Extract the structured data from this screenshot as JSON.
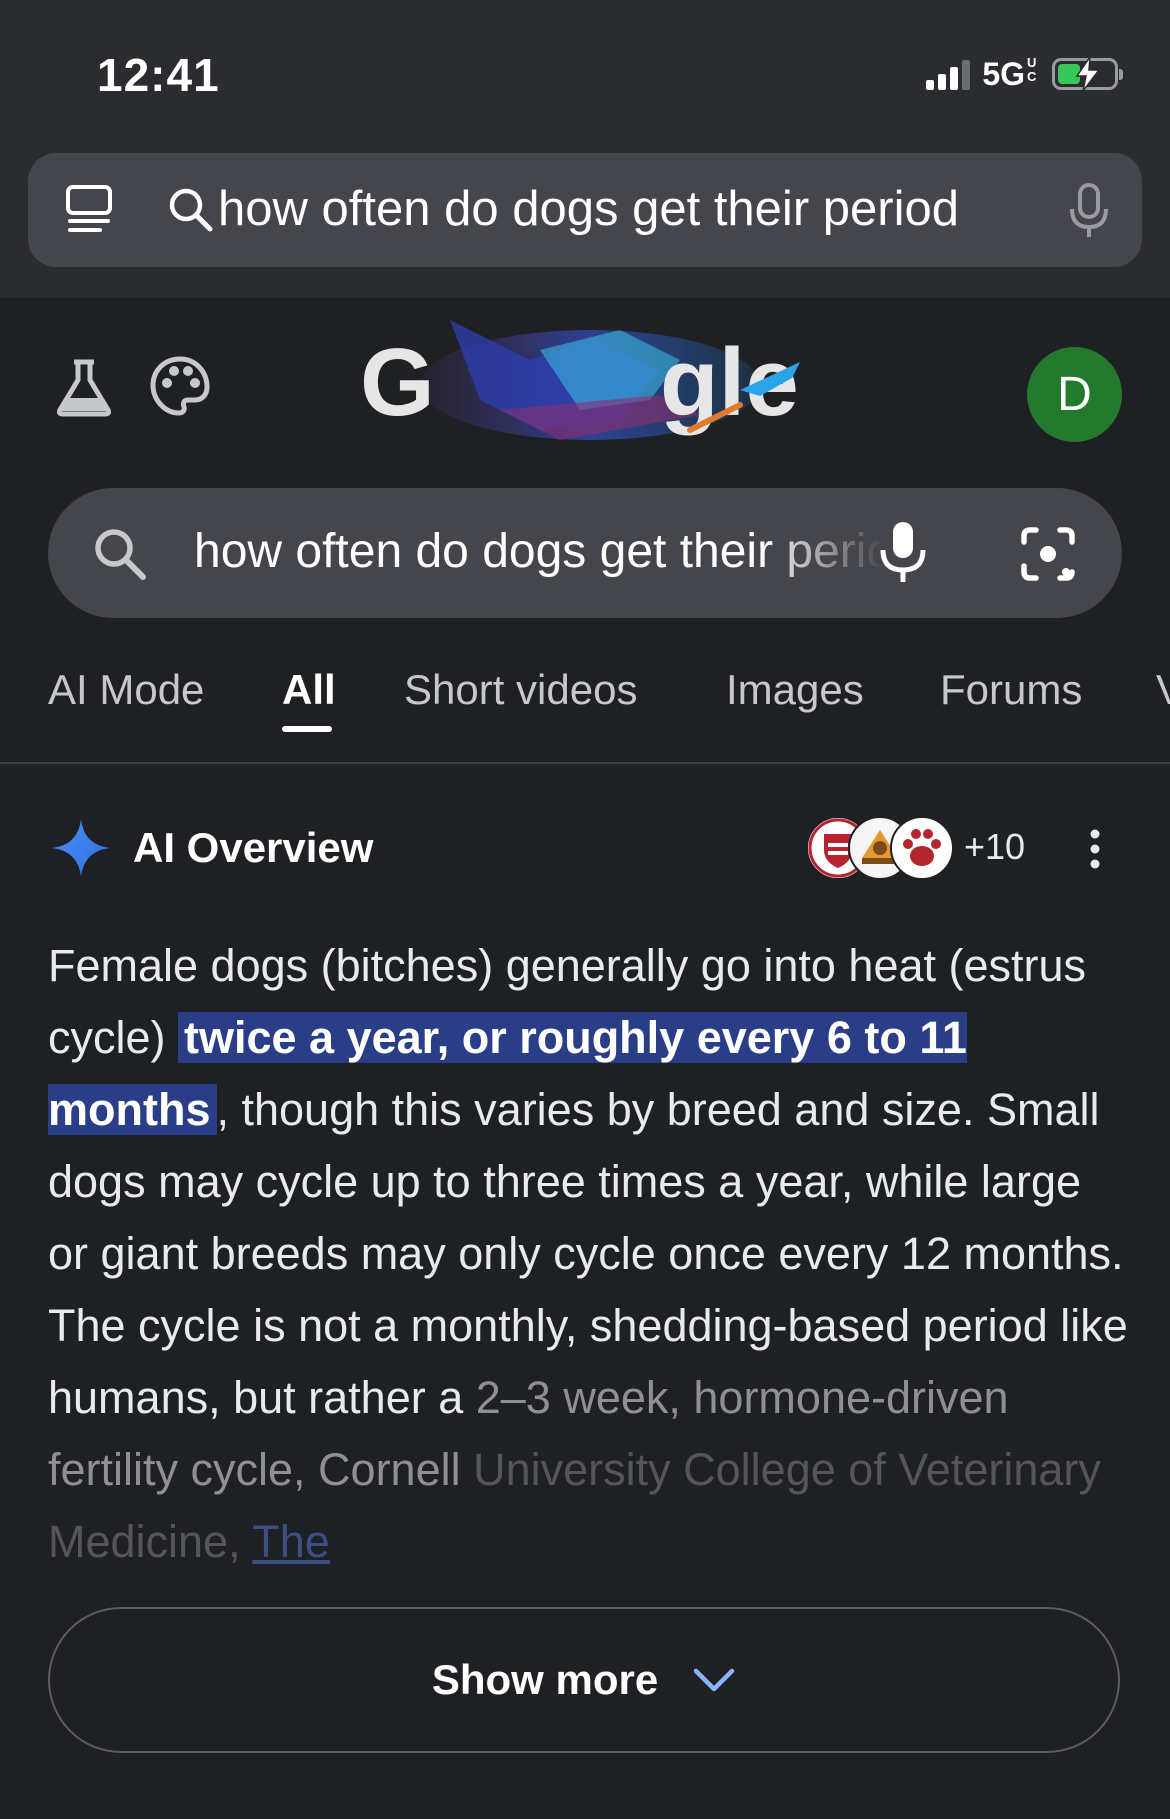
{
  "status_bar": {
    "time": "12:41",
    "network": "5G",
    "network_suffix": "UC",
    "battery_charging": true
  },
  "browser": {
    "url_text": "how often do dogs get their period"
  },
  "header": {
    "logo_text": "Google",
    "avatar_letter": "D",
    "avatar_color": "#237a2c"
  },
  "search": {
    "query": "how often do dogs get their period"
  },
  "tabs": [
    {
      "label": "AI Mode"
    },
    {
      "label": "All",
      "active": true
    },
    {
      "label": "Short videos"
    },
    {
      "label": "Images"
    },
    {
      "label": "Forums"
    },
    {
      "label": "V"
    }
  ],
  "ai_overview": {
    "title": "AI Overview",
    "sources_extra": "+10",
    "text_part1": "Female dogs (bitches) generally go into heat (estrus cycle) ",
    "highlight": "twice a year, or roughly every 6 to 11 months",
    "text_part2": ", though this varies by breed and size. Small dogs may cycle up to three times a year, while large or giant breeds may only cycle once every 12 months. The cycle is not a monthly, shedding-based period like humans, but rather a ",
    "text_fade1": "2–3 week, hormone-driven fertility cycle, Cornell ",
    "text_fade2": "University College of Veterinary Medicine, ",
    "link_text": "The",
    "show_more_label": "Show more",
    "highlight_color": "#2a3e87"
  }
}
